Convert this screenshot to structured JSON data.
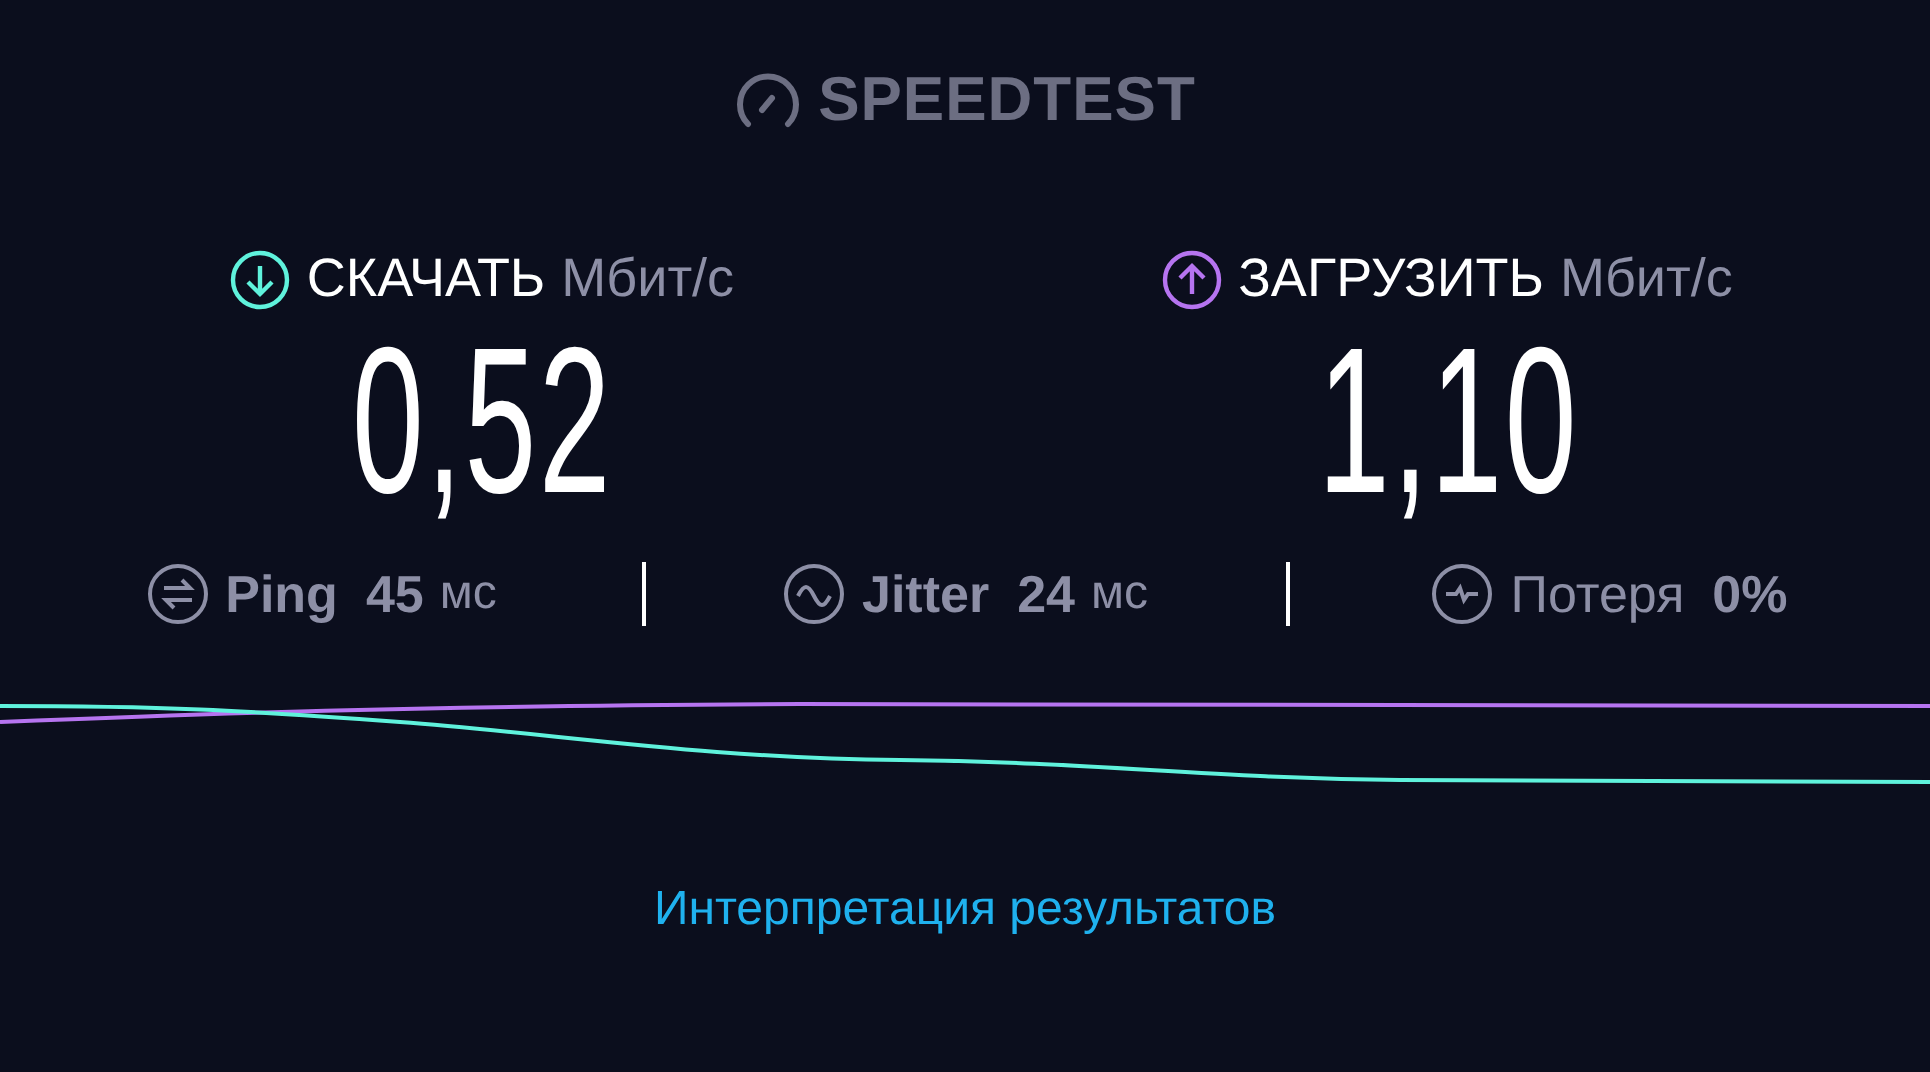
{
  "logo": {
    "text": "SPEEDTEST"
  },
  "speeds": [
    {
      "kind": "download",
      "label": "СКАЧАТЬ",
      "unit": "Мбит/с",
      "value": "0,52",
      "color": "#5ff2dc"
    },
    {
      "kind": "upload",
      "label": "ЗАГРУЗИТЬ",
      "unit": "Мбит/с",
      "value": "1,10",
      "color": "#b674f0"
    }
  ],
  "metrics": [
    {
      "kind": "ping",
      "label": "Ping",
      "value": "45",
      "unit": "мс"
    },
    {
      "kind": "jitter",
      "label": "Jitter",
      "value": "24",
      "unit": "мс"
    },
    {
      "kind": "loss",
      "label": "Потеря",
      "value": "0%"
    }
  ],
  "link": {
    "text": "Интерпретация результатов"
  }
}
